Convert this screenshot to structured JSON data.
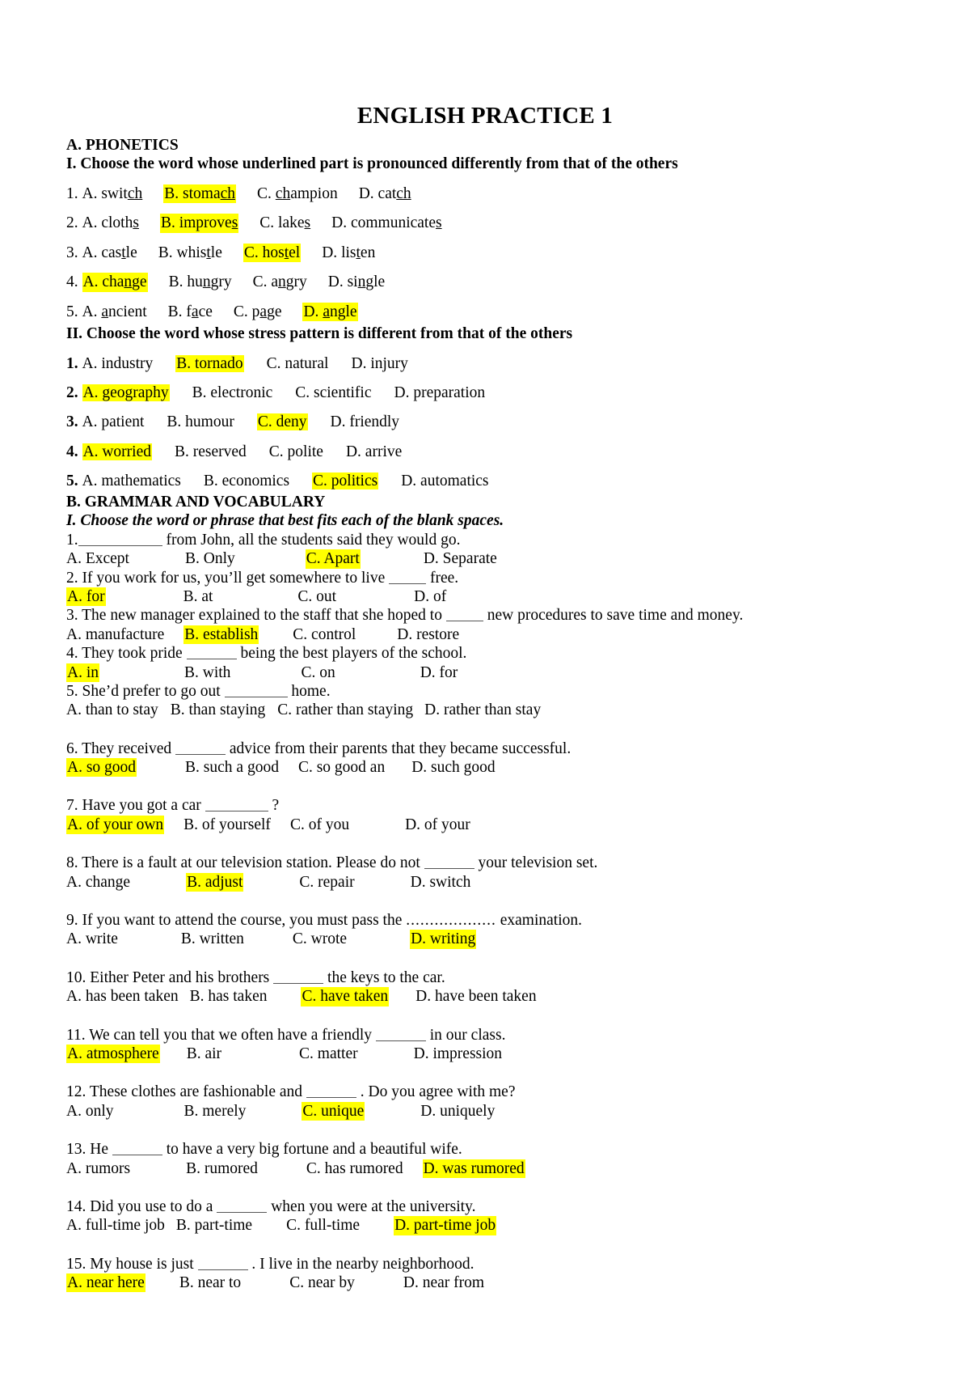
{
  "document": {
    "title": "ENGLISH PRACTICE 1",
    "highlight_color": "#ffff00",
    "text_color": "#000000",
    "background_color": "#ffffff"
  },
  "sections": {
    "a": {
      "heading": "A. PHONETICS",
      "part1_heading": "I. Choose the word whose underlined part is pronounced differently from that of the others",
      "part1_questions": [
        {
          "num": "1.",
          "options": [
            {
              "label": "A. ",
              "pre": "swit",
              "mark": "ch",
              "post": "",
              "highlight": false
            },
            {
              "label": "B. ",
              "pre": "stoma",
              "mark": "ch",
              "post": "",
              "highlight": true
            },
            {
              "label": "C. ",
              "pre": "",
              "mark": "ch",
              "post": "ampion",
              "highlight": false
            },
            {
              "label": "D. ",
              "pre": "cat",
              "mark": "ch",
              "post": "",
              "highlight": false
            }
          ]
        },
        {
          "num": "2.",
          "options": [
            {
              "label": "A. ",
              "pre": "cloth",
              "mark": "s",
              "post": "",
              "highlight": false
            },
            {
              "label": "B. ",
              "pre": "improve",
              "mark": "s",
              "post": "",
              "highlight": true
            },
            {
              "label": "C. ",
              "pre": "lake",
              "mark": "s",
              "post": "",
              "highlight": false
            },
            {
              "label": "D. ",
              "pre": "communicate",
              "mark": "s",
              "post": "",
              "highlight": false
            }
          ]
        },
        {
          "num": "3.",
          "options": [
            {
              "label": "A. ",
              "pre": "cas",
              "mark": "t",
              "post": "le",
              "highlight": false
            },
            {
              "label": "B. ",
              "pre": "whis",
              "mark": "t",
              "post": "le",
              "highlight": false
            },
            {
              "label": "C. ",
              "pre": "hos",
              "mark": "t",
              "post": "el",
              "highlight": true
            },
            {
              "label": "D. ",
              "pre": "lis",
              "mark": "t",
              "post": "en",
              "highlight": false
            }
          ]
        },
        {
          "num": "4.",
          "options": [
            {
              "label": "A. ",
              "pre": "cha",
              "mark": "n",
              "post": "ge",
              "highlight": true
            },
            {
              "label": "B. ",
              "pre": "hu",
              "mark": "n",
              "post": "gry",
              "highlight": false
            },
            {
              "label": "C. ",
              "pre": "a",
              "mark": "n",
              "post": "gry",
              "highlight": false
            },
            {
              "label": "D. ",
              "pre": "si",
              "mark": "n",
              "post": "gle",
              "highlight": false
            }
          ]
        },
        {
          "num": "5.",
          "options": [
            {
              "label": "A. ",
              "pre": "",
              "mark": "a",
              "post": "ncient",
              "highlight": false
            },
            {
              "label": "B. ",
              "pre": "f",
              "mark": "a",
              "post": "ce",
              "highlight": false
            },
            {
              "label": "C. ",
              "pre": "p",
              "mark": "a",
              "post": "ge",
              "highlight": false
            },
            {
              "label": "D. ",
              "pre": "",
              "mark": "a",
              "post": "ngle",
              "highlight": true
            }
          ]
        }
      ],
      "part2_heading": "II. Choose the word whose stress pattern is different from that of the others",
      "part2_questions": [
        {
          "num": "1.",
          "options": [
            {
              "text": "A. industry",
              "highlight": false
            },
            {
              "text": "B. tornado",
              "highlight": true
            },
            {
              "text": "C. natural",
              "highlight": false
            },
            {
              "text": "D. injury",
              "highlight": false
            }
          ]
        },
        {
          "num": "2.",
          "options": [
            {
              "text": "A. geography",
              "highlight": true
            },
            {
              "text": "B. electronic",
              "highlight": false
            },
            {
              "text": "C. scientific",
              "highlight": false
            },
            {
              "text": "D. preparation",
              "highlight": false
            }
          ]
        },
        {
          "num": "3.",
          "options": [
            {
              "text": "A. patient",
              "highlight": false
            },
            {
              "text": "B. humour",
              "highlight": false
            },
            {
              "text": "C. deny",
              "highlight": true
            },
            {
              "text": "D. friendly",
              "highlight": false
            }
          ]
        },
        {
          "num": "4.",
          "options": [
            {
              "text": "A. worried",
              "highlight": true
            },
            {
              "text": "B. reserved",
              "highlight": false
            },
            {
              "text": "C. polite",
              "highlight": false
            },
            {
              "text": "D. arrive",
              "highlight": false
            }
          ]
        },
        {
          "num": "5.",
          "options": [
            {
              "text": "A. mathematics",
              "highlight": false
            },
            {
              "text": "B. economics",
              "highlight": false
            },
            {
              "text": "C. politics",
              "highlight": true
            },
            {
              "text": "D. automatics",
              "highlight": false
            }
          ]
        }
      ]
    },
    "b": {
      "heading": "B. GRAMMAR AND VOCABULARY",
      "part1_heading": "I. Choose the word or phrase that best fits each of the blank spaces.",
      "questions": [
        {
          "num": "1.",
          "stem_pre": "",
          "stem_post": " from John, all the students said they would go.",
          "blank": "xl",
          "options": [
            {
              "text": "A. Except",
              "highlight": false
            },
            {
              "text": "B. Only",
              "highlight": false
            },
            {
              "text": "C. Apart",
              "highlight": true
            },
            {
              "text": "D. Separate",
              "highlight": false
            }
          ]
        },
        {
          "num": "2.",
          "stem_pre": " If you work for us, you’ll get somewhere to live ",
          "stem_post": " free.",
          "blank": "sm",
          "options": [
            {
              "text": "A. for",
              "highlight": true
            },
            {
              "text": "B. at",
              "highlight": false
            },
            {
              "text": "C. out",
              "highlight": false
            },
            {
              "text": "D. of",
              "highlight": false
            }
          ]
        },
        {
          "num": "3.",
          "stem_pre": " The new manager explained to the staff that she hoped to ",
          "stem_post": " new procedures to save time and money.",
          "blank": "sm",
          "options": [
            {
              "text": "A. manufacture",
              "highlight": false
            },
            {
              "text": "B. establish",
              "highlight": true
            },
            {
              "text": "C.  control",
              "highlight": false
            },
            {
              "text": "D. restore",
              "highlight": false
            }
          ]
        },
        {
          "num": "4.",
          "stem_pre": " They took pride ",
          "stem_post": " being the best players of the school.",
          "blank": "md",
          "options": [
            {
              "text": "A. in",
              "highlight": true
            },
            {
              "text": "B. with",
              "highlight": false
            },
            {
              "text": "C. on",
              "highlight": false
            },
            {
              "text": "D. for",
              "highlight": false
            }
          ]
        },
        {
          "num": "5.",
          "stem_pre": " She’d prefer to go out ",
          "stem_post": " home.",
          "blank": "lg",
          "options": [
            {
              "text": "A. than to stay",
              "highlight": false
            },
            {
              "text": "B. than staying",
              "highlight": false
            },
            {
              "text": "C. rather than staying",
              "highlight": false
            },
            {
              "text": "D. rather than stay",
              "highlight": false
            }
          ]
        },
        {
          "num": "6.",
          "stem_pre": " They received ",
          "stem_post": " advice from their parents that they became successful.",
          "blank": "md",
          "options": [
            {
              "text": "A. so good",
              "highlight": true
            },
            {
              "text": "B. such a good",
              "highlight": false
            },
            {
              "text": "C. so good an",
              "highlight": false
            },
            {
              "text": "D. such good",
              "highlight": false
            }
          ]
        },
        {
          "num": "7.",
          "stem_pre": " Have you got a car ",
          "stem_post": " ?",
          "blank": "lg",
          "options": [
            {
              "text": "A. of your own",
              "highlight": true
            },
            {
              "text": "B. of yourself",
              "highlight": false
            },
            {
              "text": "C. of you",
              "highlight": false
            },
            {
              "text": "D. of your",
              "highlight": false
            }
          ]
        },
        {
          "num": "8.",
          "stem_pre": " There is a fault at our television station. Please do not ",
          "stem_post": " your television set.",
          "blank": "md",
          "options": [
            {
              "text": "A. change",
              "highlight": false
            },
            {
              "text": "B. adjust",
              "highlight": true
            },
            {
              "text": "C. repair",
              "highlight": false
            },
            {
              "text": "D. switch",
              "highlight": false
            }
          ]
        },
        {
          "num": "9.",
          "stem_pre": "  If you want to attend the course, you must pass the ",
          "stem_post": " examination.",
          "blank": "dots",
          "dots": "...................",
          "options": [
            {
              "text": "A. write",
              "highlight": false
            },
            {
              "text": "B. written",
              "highlight": false
            },
            {
              "text": "C. wrote",
              "highlight": false
            },
            {
              "text": "D. writing",
              "highlight": true
            }
          ]
        },
        {
          "num": "10.",
          "stem_pre": " Either Peter and his brothers ",
          "stem_post": " the keys to the car.",
          "blank": "md",
          "options": [
            {
              "text": "A. has been taken",
              "highlight": false
            },
            {
              "text": "B. has taken",
              "highlight": false
            },
            {
              "text": "C. have taken",
              "highlight": true
            },
            {
              "text": "D. have been taken",
              "highlight": false
            }
          ]
        },
        {
          "num": "11.",
          "stem_pre": " We can tell you that we often have a friendly ",
          "stem_post": " in our class.",
          "blank": "md",
          "options": [
            {
              "text": "A. atmosphere",
              "highlight": true
            },
            {
              "text": "B. air",
              "highlight": false
            },
            {
              "text": "C. matter",
              "highlight": false
            },
            {
              "text": "D. impression",
              "highlight": false
            }
          ]
        },
        {
          "num": "12.",
          "stem_pre": " These clothes are fashionable and ",
          "stem_post": " . Do you agree with me?",
          "blank": "md",
          "options": [
            {
              "text": "A. only",
              "highlight": false
            },
            {
              "text": "B. merely",
              "highlight": false
            },
            {
              "text": "C. unique",
              "highlight": true
            },
            {
              "text": "D. uniquely",
              "highlight": false
            }
          ]
        },
        {
          "num": "13.",
          "stem_pre": " He ",
          "stem_post": " to have a very big fortune and a beautiful wife.",
          "blank": "md",
          "options": [
            {
              "text": "A. rumors",
              "highlight": false
            },
            {
              "text": "B. rumored",
              "highlight": false
            },
            {
              "text": "C. has rumored",
              "highlight": false
            },
            {
              "text": "D. was rumored",
              "highlight": true
            }
          ]
        },
        {
          "num": "14.",
          "stem_pre": " Did you use to do a ",
          "stem_post": " when you were at the university.",
          "blank": "md",
          "options": [
            {
              "text": "A. full-time job",
              "highlight": false
            },
            {
              "text": "B. part-time",
              "highlight": false
            },
            {
              "text": "C. full-time",
              "highlight": false
            },
            {
              "text": "D. part-time job",
              "highlight": true
            }
          ]
        },
        {
          "num": "15.",
          "stem_pre": " My house is just ",
          "stem_post": " . I live in the nearby neighborhood.",
          "blank": "md",
          "options": [
            {
              "text": "A. near here",
              "highlight": true
            },
            {
              "text": "B. near to",
              "highlight": false
            },
            {
              "text": "C. near by",
              "highlight": false
            },
            {
              "text": "D. near from",
              "highlight": false
            }
          ]
        }
      ]
    }
  }
}
